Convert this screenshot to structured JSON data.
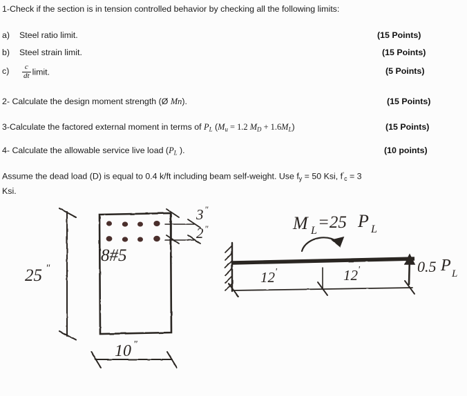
{
  "document": {
    "type": "exam-question-sheet",
    "background_color": "#fcfcfc",
    "ink_color": "#2a2522"
  },
  "questions": {
    "q1": {
      "prompt": "1-Check if the section is in tension controlled behavior by checking all the following limits:",
      "items": [
        {
          "marker": "a)",
          "text": "Steel ratio limit.",
          "points": "(15 Points)"
        },
        {
          "marker": "b)",
          "text": "Steel strain limit.",
          "points": "(15 Points)"
        },
        {
          "marker": "c)",
          "text_before_fraction": "",
          "fraction_numerator": "c",
          "fraction_denominator": "dt",
          "text_after_fraction": "limit.",
          "points": "(5 Points)"
        }
      ]
    },
    "q2": {
      "text_a": "2- Calculate the design moment strength (Ø ",
      "math_mn": "Mn",
      "text_b": ").",
      "points": "(15 Points)"
    },
    "q3": {
      "text_a": "3-Calculate the factored external moment in terms of ",
      "math_pl": "P",
      "math_pl_sub": "L",
      "text_b": " (",
      "math_mu": "M",
      "math_mu_sub": "u",
      "math_eq": " = 1.2 ",
      "math_md": "M",
      "math_md_sub": "D",
      "math_plus": " + 1.6",
      "math_ml": "M",
      "math_ml_sub": "L",
      "text_c": ")",
      "points": "(15 Points)"
    },
    "q4": {
      "text_a": "4- Calculate the allowable service live load (",
      "math_pl": "P",
      "math_pl_sub": "L",
      "text_b": " ).",
      "points": "(10 points)"
    },
    "assumption": {
      "line1_a": "Assume the dead load (D) is equal to 0.4 k/ft including beam self-weight. Use  f",
      "line1_sub1": "y",
      "line1_b": " = 50 Ksi, f",
      "line1_sup": "’",
      "line1_sub2": "c",
      "line1_c": " = 3",
      "line2": "Ksi."
    }
  },
  "diagrams": {
    "cross_section": {
      "name": "beam-cross-section",
      "height_label": "25",
      "height_unit": "\"",
      "width_label": "10",
      "width_unit": "\"",
      "rebar_label": "8#5",
      "rebar_rows": 2,
      "rebar_per_row": 4,
      "cover_top_label": "3",
      "cover_top_unit": "\"",
      "spacing_label": "2",
      "spacing_unit": "\""
    },
    "beam_elevation": {
      "name": "cantilever-beam-diagram",
      "moment_label": "ML=25 PL",
      "moment_label_m": "M",
      "moment_label_m_sub": "L",
      "moment_label_eq": "=25 ",
      "moment_label_p": "P",
      "moment_label_p_sub": "L",
      "span_left_label": "12",
      "span_left_unit": "'",
      "span_right_label": "12",
      "span_right_unit": "'",
      "load_label": "0.5P",
      "load_label_sub": "L",
      "support_type": "fixed"
    }
  }
}
